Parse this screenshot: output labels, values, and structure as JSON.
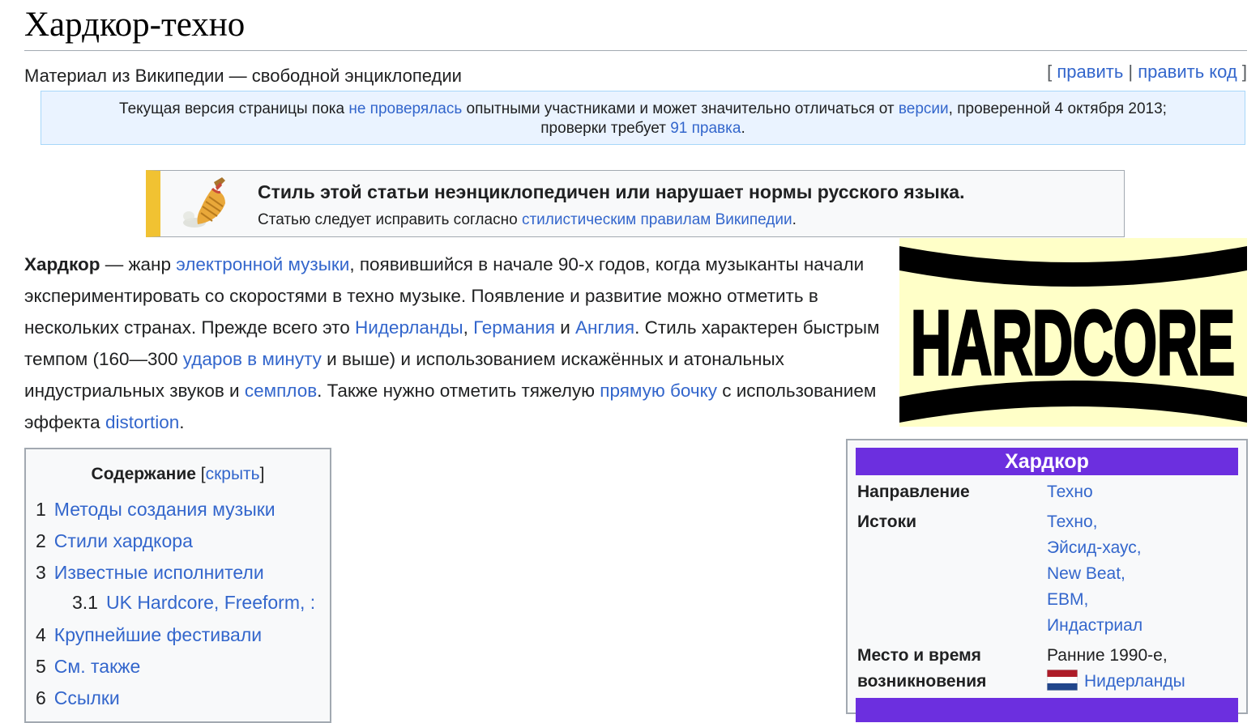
{
  "page": {
    "title": "Хардкор-техно",
    "tagline": "Материал из Википедии — свободной энциклопедии"
  },
  "edit_links": {
    "open": "[",
    "edit": "править",
    "sep": "|",
    "edit_source": "править код",
    "close": "]"
  },
  "rev_notice": {
    "t1": "Текущая версия страницы пока ",
    "l1": "не проверялась",
    "t2": " опытными участниками и может значительно отличаться от ",
    "l2": "версии",
    "t3": ", проверенной 4 октября 2013;",
    "t4": "проверки требует ",
    "l3": "91 правка",
    "t5": "."
  },
  "ambox": {
    "icon": "broom-icon",
    "accent_color": "#f1c232",
    "title": "Стиль этой статьи неэнциклопедичен или нарушает нормы русского языка.",
    "text_before": "Статью следует исправить согласно ",
    "link": "стилистическим правилам Википедии",
    "text_after": "."
  },
  "lead": {
    "bold": "Хардкор",
    "t1": " — жанр ",
    "l1": "электронной музыки",
    "t2": ", появившийся в начале 90-х годов, когда музыканты начали экспериментировать со скоростями в техно музыке. Появление и развитие можно отметить в нескольких странах. Прежде всего это ",
    "l2": "Нидерланды",
    "t3": ", ",
    "l3": "Германия",
    "t4": " и ",
    "l4": "Англия",
    "t5": ". Стиль характерен быстрым темпом (160—300 ",
    "l5": "ударов в минуту",
    "t6": " и выше) и использованием искажённых и атональных индустриальных звуков и ",
    "l6": "семплов",
    "t7": ". Также нужно отметить тяжелую ",
    "l7": "прямую бочку",
    "t8": " с использованием эффекта ",
    "l8": "distortion",
    "t9": "."
  },
  "logo": {
    "text": "HARDCORE",
    "background": "#ffffc8"
  },
  "toc": {
    "heading": "Содержание",
    "toggle_open": "[",
    "toggle": "скрыть",
    "toggle_close": "]",
    "items": [
      {
        "num": "1",
        "label": "Методы создания музыки"
      },
      {
        "num": "2",
        "label": "Стили хардкора"
      },
      {
        "num": "3",
        "label": "Известные исполнители"
      },
      {
        "num": "3.1",
        "label": "UK Hardcore, Freeform, :"
      },
      {
        "num": "4",
        "label": "Крупнейшие фестивали"
      },
      {
        "num": "5",
        "label": "См. также"
      },
      {
        "num": "6",
        "label": "Ссылки"
      }
    ]
  },
  "infobox": {
    "title": "Хардкор",
    "header_color": "#6c2fdf",
    "rows": [
      {
        "label": "Направление",
        "values": [
          "Техно"
        ]
      },
      {
        "label": "Истоки",
        "values": [
          "Техно,",
          "Эйсид-хаус,",
          "New Beat,",
          "EBM,",
          "Индастриал"
        ]
      },
      {
        "label_1": "Место и время",
        "label_2": "возникновения",
        "value_text": "Ранние 1990-е,",
        "value_link": "Нидерланды",
        "flag": "netherlands-flag-icon"
      }
    ]
  }
}
